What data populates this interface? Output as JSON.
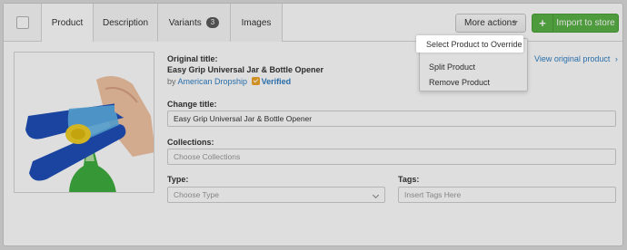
{
  "tabs": [
    {
      "label": "Product",
      "active": true
    },
    {
      "label": "Description",
      "active": false
    },
    {
      "label": "Variants",
      "badge": "3",
      "active": false
    },
    {
      "label": "Images",
      "active": false
    }
  ],
  "actions": {
    "more_label": "More actions",
    "import_label": "Import to store",
    "import_icon": "plus-icon"
  },
  "dropdown": {
    "items": [
      "Select Product to Override",
      "Split Product",
      "Remove Product"
    ],
    "highlighted_index": 0
  },
  "product": {
    "original_title_label": "Original title:",
    "original_title": "Easy Grip Universal Jar & Bottle Opener",
    "by_label": "by",
    "supplier": "American Dropship",
    "verified_label": "Verified",
    "view_original_label": "View original product",
    "change_title_label": "Change title:",
    "title_value": "Easy Grip Universal Jar & Bottle Opener",
    "collections_label": "Collections:",
    "collections_placeholder": "Choose Collections",
    "type_label": "Type:",
    "type_placeholder": "Choose Type",
    "tags_label": "Tags:",
    "tags_placeholder": "Insert Tags Here"
  },
  "colors": {
    "accent_green": "#59b246",
    "link_blue": "#2f7fc4",
    "verified_orange": "#f0a527"
  }
}
